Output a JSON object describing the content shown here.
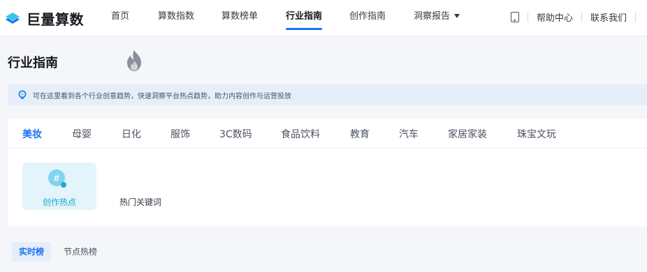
{
  "brand": {
    "name": "巨量算数",
    "accent": "#1c72f2",
    "secondary": "#35c7e8"
  },
  "nav": {
    "items": [
      {
        "label": "首页",
        "active": false
      },
      {
        "label": "算数指数",
        "active": false
      },
      {
        "label": "算数榜单",
        "active": false
      },
      {
        "label": "行业指南",
        "active": true
      },
      {
        "label": "创作指南",
        "active": false
      },
      {
        "label": "洞察报告",
        "active": false,
        "has_dropdown": true
      }
    ]
  },
  "utility": {
    "mobile_icon": "mobile-phone-icon",
    "help": "帮助中心",
    "contact": "联系我们"
  },
  "page": {
    "title": "行业指南"
  },
  "tip": {
    "icon": "lightbulb-icon",
    "text": "可在这里看到各个行业创意趋势，快速洞察平台热点趋势，助力内容创作与运营投放"
  },
  "industry_tabs": [
    {
      "label": "美妆",
      "active": true
    },
    {
      "label": "母婴",
      "active": false
    },
    {
      "label": "日化",
      "active": false
    },
    {
      "label": "服饰",
      "active": false
    },
    {
      "label": "3C数码",
      "active": false
    },
    {
      "label": "食品饮料",
      "active": false
    },
    {
      "label": "教育",
      "active": false
    },
    {
      "label": "汽车",
      "active": false
    },
    {
      "label": "家居家装",
      "active": false
    },
    {
      "label": "珠宝文玩",
      "active": false
    }
  ],
  "features": [
    {
      "label": "创作热点",
      "icon": "hashtag-search-icon",
      "active": true
    },
    {
      "label": "热门关键词",
      "icon": "fire-icon",
      "active": false
    }
  ],
  "rank_tabs": [
    {
      "label": "实时榜",
      "active": true
    },
    {
      "label": "节点热榜",
      "active": false
    }
  ]
}
